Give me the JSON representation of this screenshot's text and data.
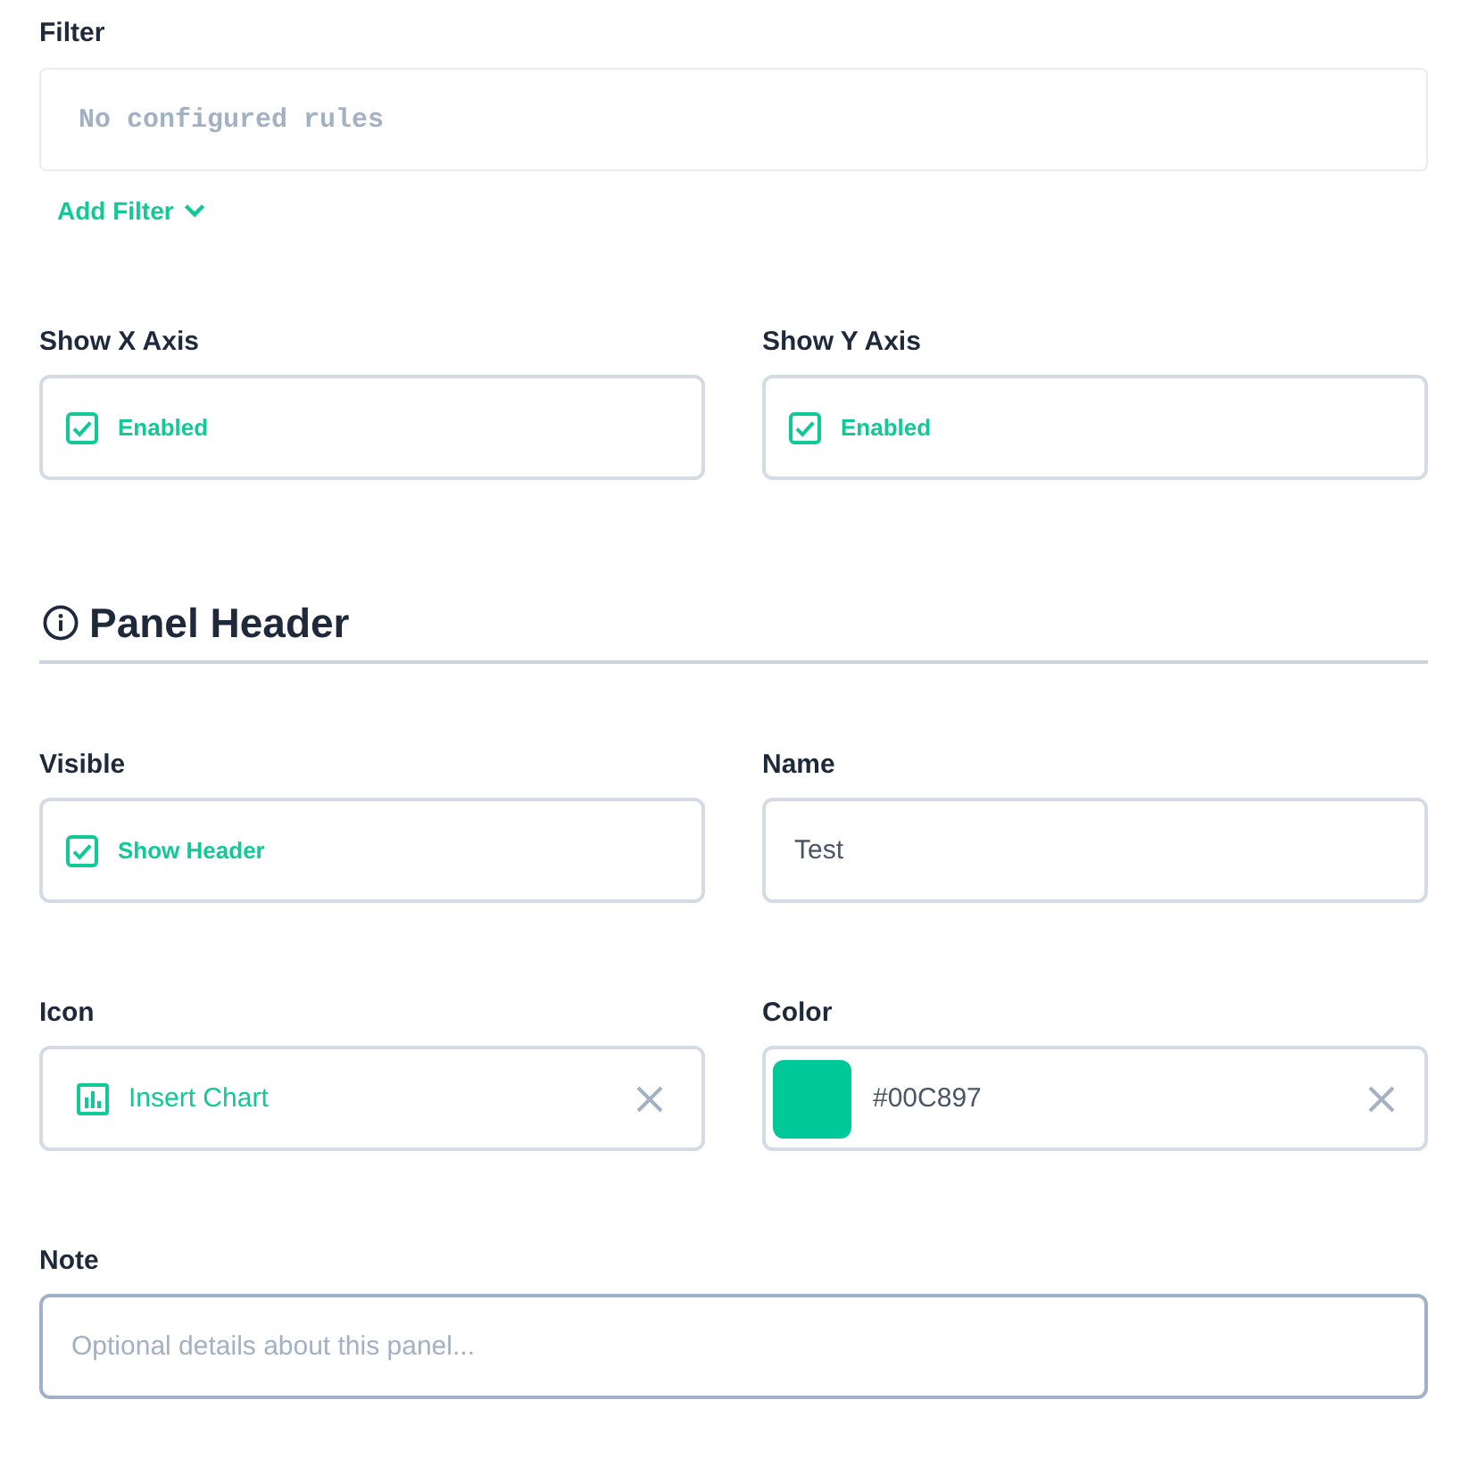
{
  "filter": {
    "label": "Filter",
    "empty_text": "No configured rules",
    "add_button": "Add Filter"
  },
  "axes": [
    {
      "label": "Show X Axis",
      "checked": true,
      "text": "Enabled"
    },
    {
      "label": "Show Y Axis",
      "checked": true,
      "text": "Enabled"
    }
  ],
  "panel_header": {
    "title": "Panel Header",
    "fields": [
      {
        "kind": "checkbox",
        "label": "Visible",
        "checked": true,
        "text": "Show Header"
      },
      {
        "kind": "text",
        "label": "Name",
        "value": "Test"
      },
      {
        "kind": "icon",
        "label": "Icon",
        "value": "Insert Chart"
      },
      {
        "kind": "color",
        "label": "Color",
        "value": "#00C897"
      }
    ],
    "note": {
      "label": "Note",
      "placeholder": "Optional details about this panel...",
      "focused": true
    }
  }
}
